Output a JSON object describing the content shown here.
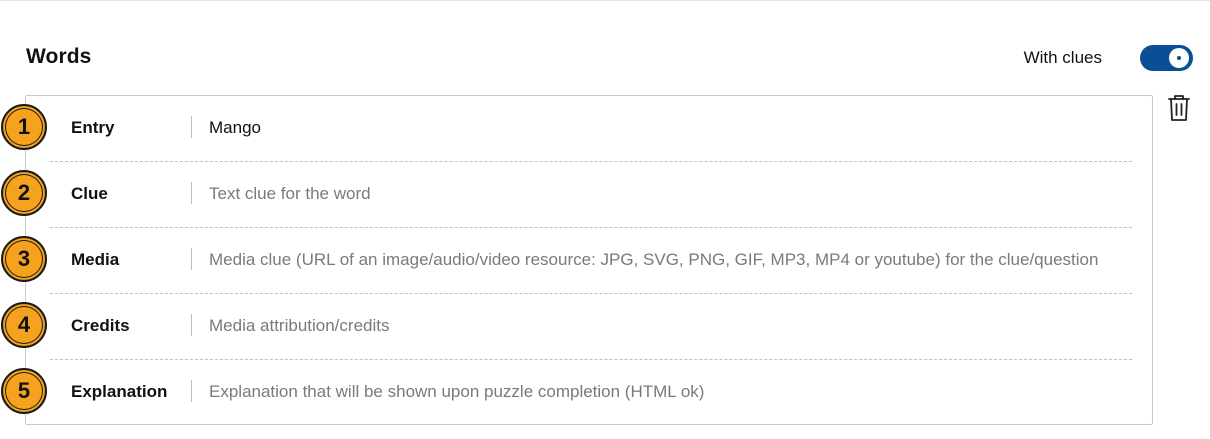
{
  "header": {
    "title": "Words",
    "clues_toggle_label": "With clues",
    "clues_enabled": true
  },
  "word_card": {
    "delete_icon": "trash-icon",
    "fields": [
      {
        "number": "1",
        "label": "Entry",
        "value": "Mango",
        "placeholder": ""
      },
      {
        "number": "2",
        "label": "Clue",
        "value": "",
        "placeholder": "Text clue for the word"
      },
      {
        "number": "3",
        "label": "Media",
        "value": "",
        "placeholder": "Media clue (URL of an image/audio/video resource: JPG, SVG, PNG, GIF, MP3, MP4 or youtube) for the clue/question"
      },
      {
        "number": "4",
        "label": "Credits",
        "value": "",
        "placeholder": "Media attribution/credits"
      },
      {
        "number": "5",
        "label": "Explanation",
        "value": "",
        "placeholder": "Explanation that will be shown upon puzzle completion (HTML ok)"
      }
    ]
  },
  "colors": {
    "badge": "#f5a31e",
    "toggle": "#0a4f96"
  }
}
